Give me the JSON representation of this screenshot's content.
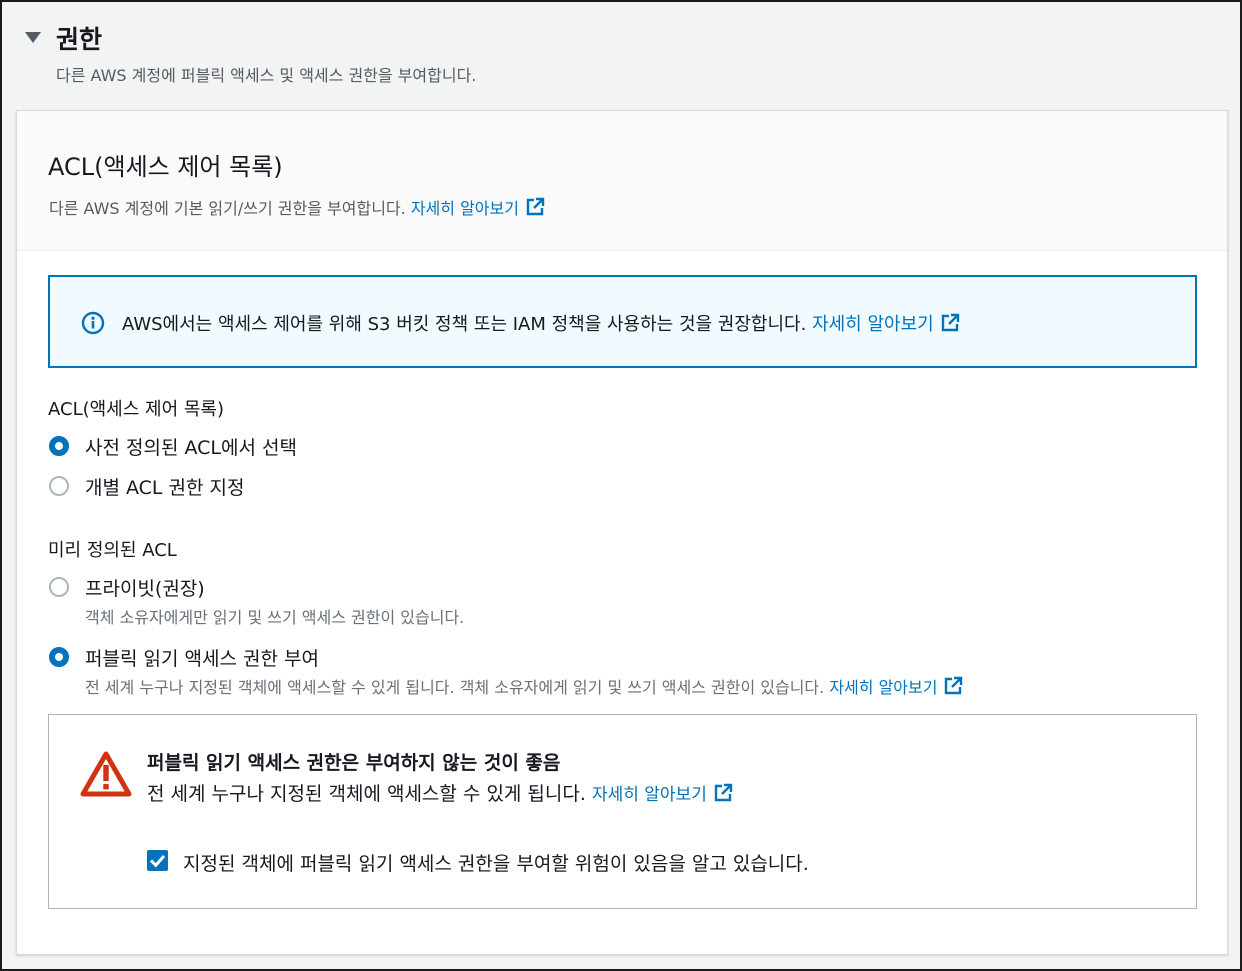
{
  "section": {
    "title": "권한",
    "description": "다른 AWS 계정에 퍼블릭 액세스 및 액세스 권한을 부여합니다."
  },
  "panel": {
    "title": "ACL(액세스 제어 목록)",
    "description": "다른 AWS 계정에 기본 읽기/쓰기 권한을 부여합니다.",
    "learn_more": "자세히 알아보기"
  },
  "info": {
    "text": "AWS에서는 액세스 제어를 위해 S3 버킷 정책 또는 IAM 정책을 사용하는 것을 권장합니다.",
    "learn_more": "자세히 알아보기"
  },
  "acl_mode": {
    "label": "ACL(액세스 제어 목록)",
    "options": [
      {
        "label": "사전 정의된 ACL에서 선택",
        "checked": true
      },
      {
        "label": "개별 ACL 권한 지정",
        "checked": false
      }
    ]
  },
  "predefined_acl": {
    "label": "미리 정의된 ACL",
    "options": [
      {
        "label": "프라이빗(권장)",
        "description": "객체 소유자에게만 읽기 및 쓰기 액세스 권한이 있습니다.",
        "checked": false
      },
      {
        "label": "퍼블릭 읽기 액세스 권한 부여",
        "description": "전 세계 누구나 지정된 객체에 액세스할 수 있게 됩니다. 객체 소유자에게 읽기 및 쓰기 액세스 권한이 있습니다.",
        "learn_more": "자세히 알아보기",
        "checked": true
      }
    ]
  },
  "warning": {
    "title": "퍼블릭 읽기 액세스 권한은 부여하지 않는 것이 좋음",
    "text": "전 세계 누구나 지정된 객체에 액세스할 수 있게 됩니다.",
    "learn_more": "자세히 알아보기",
    "acknowledge": "지정된 객체에 퍼블릭 읽기 액세스 권한을 부여할 위험이 있음을 알고 있습니다.",
    "acknowledged": true
  },
  "colors": {
    "link": "#0073bb",
    "warning": "#d13212",
    "info_bg": "#f1faff"
  }
}
